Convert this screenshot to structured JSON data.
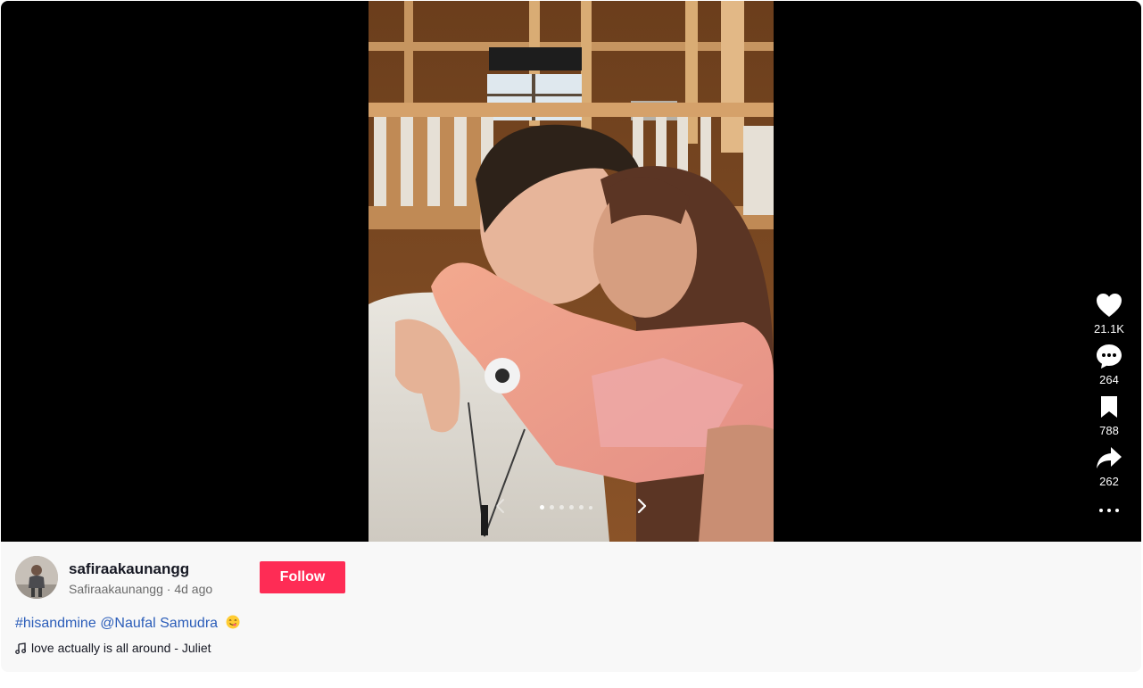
{
  "post": {
    "author_handle": "safiraakaunangg",
    "author_name": "Safiraakaunangg",
    "separator": "·",
    "posted_ago": "4d ago",
    "follow_label": "Follow",
    "caption_hashtag": "#hisandmine",
    "caption_mention": "@Naufal Samudra",
    "caption_emoji": "yum-face-emoji",
    "music": "love actually is all around - Juliet"
  },
  "carousel": {
    "total_slides": 6,
    "current_slide": 1
  },
  "actions": {
    "likes": "21.1K",
    "comments": "264",
    "saves": "788",
    "shares": "262"
  },
  "colors": {
    "accent": "#fe2c55",
    "link": "#2b5db9",
    "viewer_bg": "#000000",
    "panel_bg": "#f8f8f8"
  },
  "icons": {
    "like": "heart-icon",
    "comment": "comment-bubble-icon",
    "save": "bookmark-icon",
    "share": "share-arrow-icon",
    "more": "more-dots-icon",
    "prev": "chevron-left-icon",
    "next": "chevron-right-icon",
    "music": "music-note-icon"
  }
}
